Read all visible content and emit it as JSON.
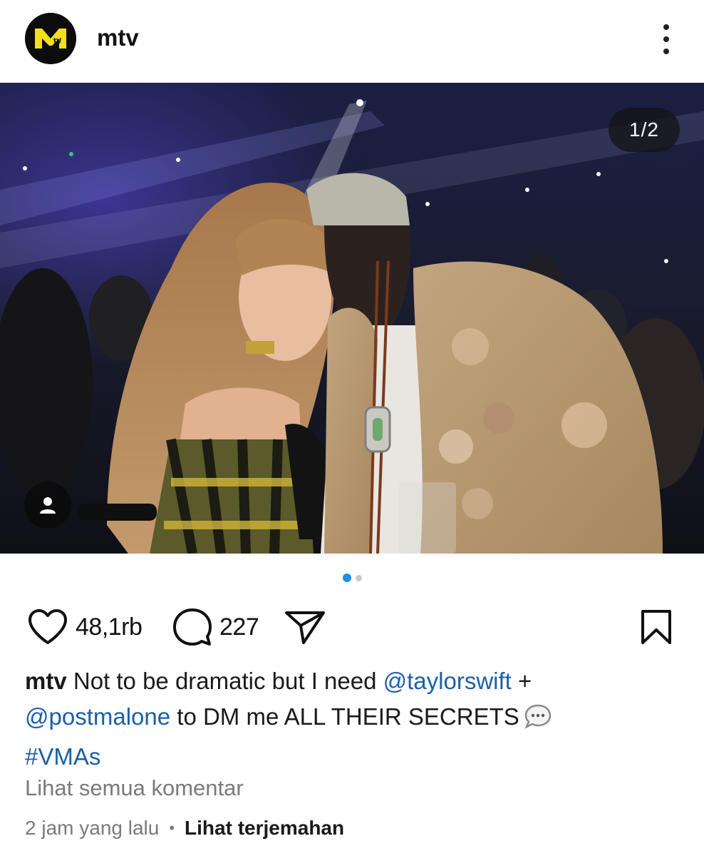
{
  "header": {
    "username": "mtv",
    "avatar_icon": "mtv-logo-icon",
    "more_icon": "more-vertical-icon"
  },
  "photo": {
    "counter": "1/2",
    "tag_icon": "user-tag-icon",
    "slide_current": 1,
    "slide_total": 2
  },
  "actions": {
    "like_icon": "heart-icon",
    "likes": "48,1rb",
    "comment_icon": "comment-bubble-icon",
    "comments": "227",
    "share_icon": "send-icon",
    "save_icon": "bookmark-icon"
  },
  "caption": {
    "username": "mtv",
    "text_1": "Not to be dramatic but I need",
    "mention_1": "@taylorswift",
    "text_2": "+",
    "mention_2": "@postmalone",
    "text_3": "to DM me ALL THEIR SECRETS",
    "emoji_icon": "speech-bubble-emoji-icon",
    "hashtag": "#VMAs"
  },
  "footer": {
    "view_comments": "Lihat semua komentar",
    "time": "2 jam yang lalu",
    "separator": "•",
    "translate": "Lihat terjemahan"
  },
  "colors": {
    "link": "#1b5fa8",
    "active_dot": "#1e8fe6",
    "muted_text": "#7a7a7a"
  }
}
